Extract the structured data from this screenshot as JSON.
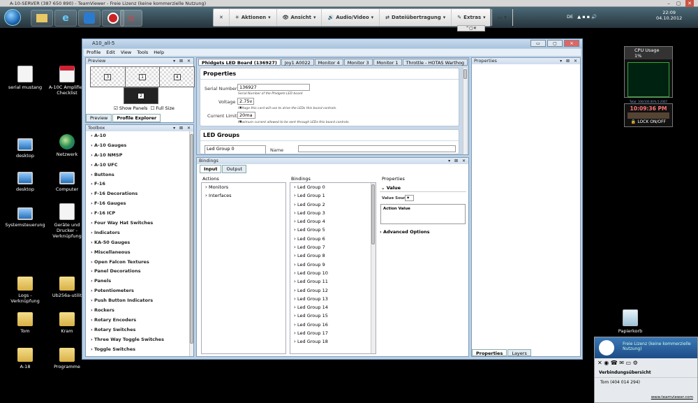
{
  "teamviewer_bar": {
    "title": "A-10-SERVER (387 650 890) - TeamViewer - Freie Lizenz (keine kommerzielle Nutzung)"
  },
  "teamviewer_toolbar": {
    "close": "✕",
    "items": [
      {
        "icon": "✳",
        "label": "Aktionen"
      },
      {
        "icon": "👁",
        "label": "Ansicht"
      },
      {
        "icon": "🔊",
        "label": "Audio/Video"
      },
      {
        "icon": "⇄",
        "label": "Dateiübertragung"
      },
      {
        "icon": "✎",
        "label": "Extras"
      },
      {
        "icon": "▭",
        "label": ""
      }
    ],
    "collapse": "⌃▢✕"
  },
  "taskbar": {
    "icons": [
      "folder",
      "ie",
      "teamviewer",
      "no-smoking"
    ]
  },
  "tray": {
    "lang": "DE",
    "time": "22:09",
    "date": "04.10.2012"
  },
  "desktop_icons": [
    {
      "name": "serial mustang",
      "type": "doc"
    },
    {
      "name": "A-10C Amplified Checklist",
      "type": "pdf"
    },
    {
      "name": "desktop",
      "type": "mon"
    },
    {
      "name": "Netzwerk",
      "type": "globe"
    },
    {
      "name": "desktop",
      "type": "mon"
    },
    {
      "name": "Computer",
      "type": "mon"
    },
    {
      "name": "Systemsteuerung",
      "type": "mon"
    },
    {
      "name": "Geräte und Drucker - Verknüpfung",
      "type": "doc"
    },
    {
      "name": "Logs - Verknüpfung",
      "type": "fold"
    },
    {
      "name": "Ub256a-utilit",
      "type": "fold"
    },
    {
      "name": "Tom",
      "type": "fold"
    },
    {
      "name": "Kram",
      "type": "fold"
    },
    {
      "name": "A-18",
      "type": "fold"
    },
    {
      "name": "Programme",
      "type": "fold"
    },
    {
      "name": "Papierkorb",
      "type": "doc"
    }
  ],
  "app": {
    "title": "A10_all-5",
    "menu": [
      "Profile",
      "Edit",
      "View",
      "Tools",
      "Help"
    ],
    "preview": {
      "title": "Preview",
      "cells": [
        "3",
        "1",
        "4"
      ],
      "bottom_cell": "2",
      "show_panels_label": "Show Panels",
      "show_panels_checked": true,
      "full_size_label": "Full Size",
      "full_size_checked": false,
      "tabs": [
        "Preview",
        "Profile Explorer"
      ]
    },
    "toolbox": {
      "title": "Toolbox",
      "items": [
        "A-10",
        "A-10 Gauges",
        "A-10 NMSP",
        "A-10 UFC",
        "Buttons",
        "F-16",
        "F-16 Decorations",
        "F-16 Gauges",
        "F-16 ICP",
        "Four Way Hat Switches",
        "Indicators",
        "KA-50 Gauges",
        "Miscellaneous",
        "Open Falcon Textures",
        "Panel Decorations",
        "Panels",
        "Potentiometers",
        "Push Button Indicators",
        "Rockers",
        "Rotary Encoders",
        "Rotary Switches",
        "Three Way Toggle Switches",
        "Toggle Switches"
      ]
    },
    "doc_tabs": [
      "Phidgets LED Board (136927)",
      "Joy1 A0022",
      "Monitor 4",
      "Monitor 3",
      "Monitor 1",
      "Throttle - HOTAS Warthog"
    ],
    "properties_group": {
      "title": "Properties",
      "serial_label": "Serial Number",
      "serial_value": "136927",
      "serial_hint": "Serial Number of the Phidgets LED board",
      "voltage_label": "Voltage",
      "voltage_value": "2.75v",
      "voltage_hint": "Voltage this card will use to drive the LEDs this board controls.",
      "current_label": "Current Limit",
      "current_value": "20ma",
      "current_hint": "Maximum current allowed to be sent through LEDs this board controls."
    },
    "led_groups": {
      "title": "LED Groups",
      "first_item": "Led Group 0",
      "name_label": "Name"
    },
    "bindings": {
      "title": "Bindings",
      "tabs": [
        "Input",
        "Output"
      ],
      "actions_header": "Actions",
      "actions": [
        "Monitors",
        "Interfaces"
      ],
      "bindings_header": "Bindings",
      "bindings_list": [
        "Led Group 0",
        "Led Group 1",
        "Led Group 2",
        "Led Group 3",
        "Led Group 4",
        "Led Group 5",
        "Led Group 6",
        "Led Group 7",
        "Led Group 8",
        "Led Group 9",
        "Led Group 10",
        "Led Group 11",
        "Led Group 12",
        "Led Group 13",
        "Led Group 14",
        "Led Group 15",
        "Led Group 16",
        "Led Group 17",
        "Led Group 18"
      ],
      "props_header": "Properties",
      "value_header": "Value",
      "value_source_label": "Value Source",
      "action_value_label": "Action Value",
      "advanced_label": "Advanced Options"
    },
    "properties_panel": {
      "title": "Properties",
      "tabs": [
        "Properties",
        "Layers"
      ]
    },
    "pin_controls": "▾ ⊠ ✕"
  },
  "gadgets": {
    "cpu_title": "CPU Usage",
    "cpu_value": "1%",
    "clock_time": "10:09:36 PM",
    "lock_label": "LOCK ON/OFF",
    "tiny_link": "Total: 100/100.00% 5-2007"
  },
  "tv_popup": {
    "header": "Freie Lizenz (keine kommerzielle Nutzung)",
    "section": "Verbindungsübersicht",
    "row": "Tom (404 014 294)",
    "link": "www.teamviewer.com"
  }
}
